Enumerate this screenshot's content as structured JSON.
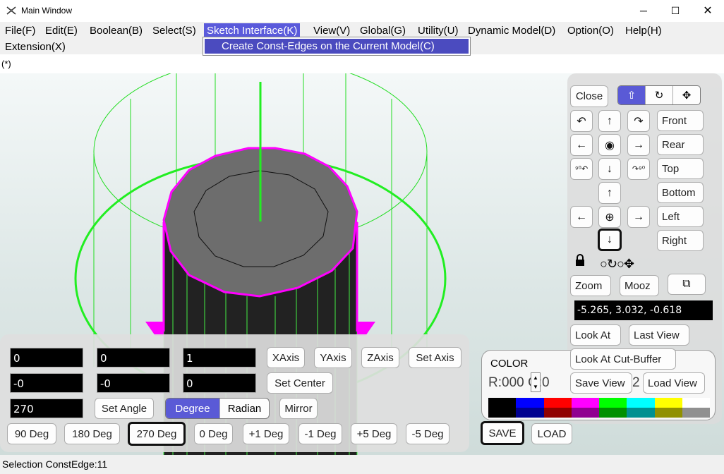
{
  "window": {
    "title": "Main Window",
    "controls": {
      "minimize": "─",
      "maximize": "☐",
      "close": "✕"
    }
  },
  "menubar": {
    "items": [
      {
        "label": "File(F)"
      },
      {
        "label": "Edit(E)"
      },
      {
        "label": "Boolean(B)"
      },
      {
        "label": "Select(S)"
      },
      {
        "label": "Sketch Interface(K)",
        "active": true
      },
      {
        "label": "View(V)"
      },
      {
        "label": "Global(G)"
      },
      {
        "label": "Utility(U)"
      },
      {
        "label": "Dynamic Model(D)"
      },
      {
        "label": "Option(O)"
      },
      {
        "label": "Help(H)"
      },
      {
        "label": "Extension(X)"
      }
    ],
    "open_submenu": {
      "item": "Create Const-Edges on the Current Model(C)"
    }
  },
  "modified_flag": "(*)",
  "navigator": {
    "close_label": "Close",
    "modes": {
      "active": "move",
      "icons": [
        "⇧",
        "↻",
        "✥"
      ]
    },
    "views": [
      "Front",
      "Rear",
      "Top",
      "Bottom",
      "Left",
      "Right"
    ],
    "zoom_label": "Zoom",
    "mooz_label": "Mooz",
    "coordinates": "-5.265, 3.032, -0.618",
    "look_at_label": "Look At",
    "last_view_label": "Last View",
    "look_at_cut_buffer_label": "Look At Cut-Buffer",
    "save_view_label": "Save View",
    "load_view_label": "Load View",
    "ring_icons": "○↻○✥"
  },
  "color_panel": {
    "title": "COLOR",
    "rgb_text": "R:000  G:0",
    "hidden_suffix": "2",
    "palette_top": [
      "#000000",
      "#0000ff",
      "#ff0000",
      "#ff00ff",
      "#00ff00",
      "#00ffff",
      "#ffff00",
      "#ffffff"
    ],
    "palette_bottom": [
      "#000000",
      "#000090",
      "#900000",
      "#900090",
      "#009000",
      "#009090",
      "#909000",
      "#909090"
    ],
    "save_label": "SAVE",
    "load_label": "LOAD"
  },
  "rotation_panel": {
    "row1": [
      "0",
      "0",
      "1"
    ],
    "row2": [
      "-0",
      "-0",
      "0"
    ],
    "angle": "270",
    "xaxis_label": "XAxis",
    "yaxis_label": "YAxis",
    "zaxis_label": "ZAxis",
    "set_axis_label": "Set Axis",
    "set_center_label": "Set Center",
    "set_angle_label": "Set Angle",
    "degree_label": "Degree",
    "radian_label": "Radian",
    "mirror_label": "Mirror",
    "presets": [
      "90 Deg",
      "180 Deg",
      "270 Deg",
      "0 Deg",
      "+1 Deg",
      "-1 Deg",
      "+5 Deg",
      "-5 Deg"
    ]
  },
  "status": {
    "text": "Selection  ConstEdge:11"
  },
  "colors": {
    "accent": "#5a5ad6",
    "wire": "#00ff00",
    "highlight": "#ff00ff",
    "solid": "#6e6e6e"
  }
}
